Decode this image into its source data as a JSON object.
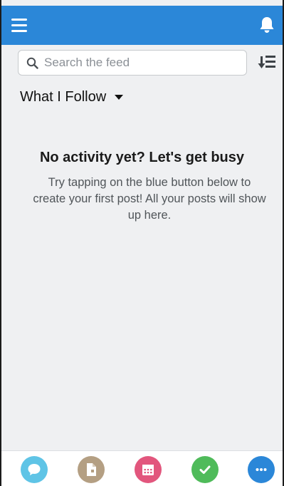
{
  "search": {
    "placeholder": "Search the feed",
    "value": ""
  },
  "feed": {
    "filter_label": "What I Follow"
  },
  "empty_state": {
    "title": "No activity yet? Let's get busy",
    "message": "Try tapping on the blue button below to create your first post! All your posts will show up here."
  },
  "colors": {
    "header": "#2b87d8",
    "background": "#eff0f2",
    "post_action": "#5fc4e6",
    "file_action": "#b49f83",
    "event_action": "#e2567d",
    "task_action": "#4fbb5a",
    "more_action": "#2b87d8"
  },
  "icons": {
    "menu": "hamburger-icon",
    "notifications": "bell-icon",
    "search": "search-icon",
    "sort": "sort-icon",
    "post": "chat-bubble-icon",
    "file": "file-icon",
    "event": "calendar-icon",
    "task": "checkmark-icon",
    "more": "ellipsis-icon"
  }
}
